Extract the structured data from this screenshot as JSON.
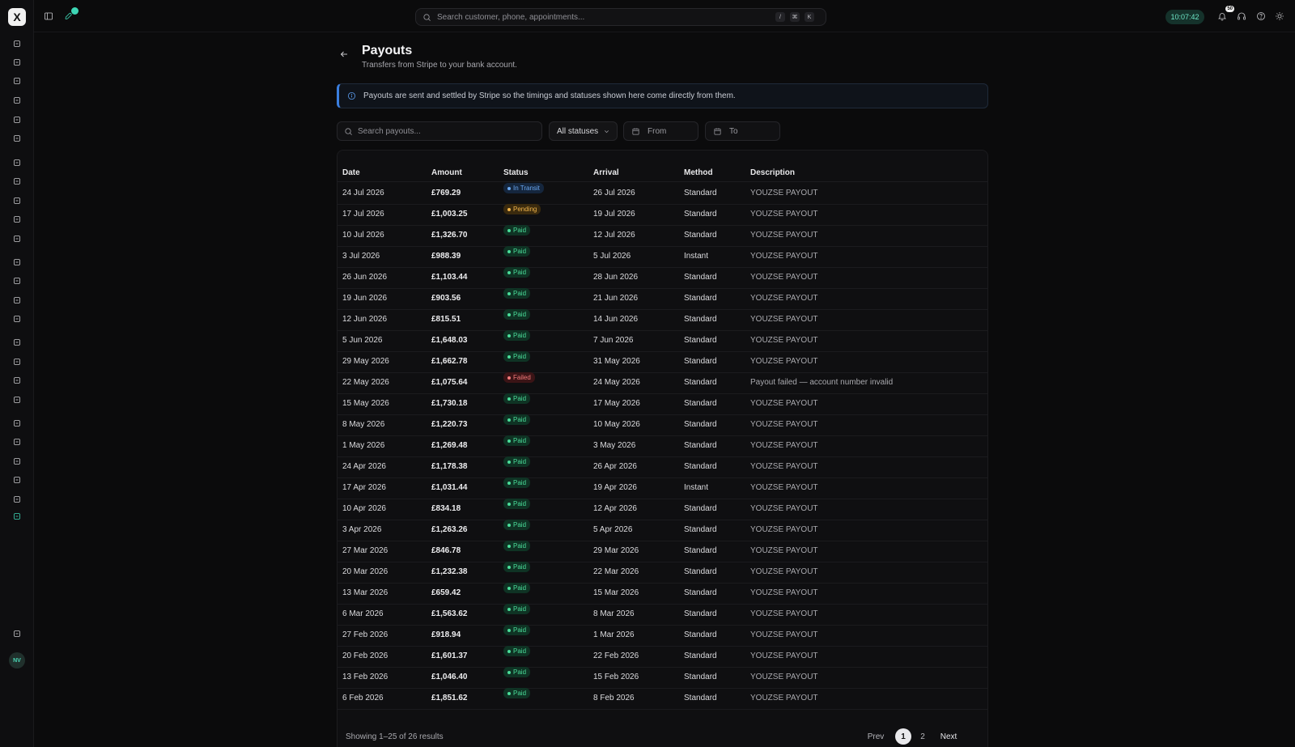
{
  "app": {
    "logo_letter": "X",
    "avatar_initials": "NV"
  },
  "topbar": {
    "search_placeholder": "Search customer, phone, appointments...",
    "kbd": [
      "/",
      "⌘",
      "K"
    ],
    "clock": "10:07:42",
    "notifications_count": "50"
  },
  "page": {
    "title": "Payouts",
    "subtitle": "Transfers from Stripe to your bank account.",
    "banner": "Payouts are sent and settled by Stripe so the timings and statuses shown here come directly from them."
  },
  "filters": {
    "search_placeholder": "Search payouts...",
    "status_selected": "All statuses",
    "from_placeholder": "From",
    "to_placeholder": "To"
  },
  "table": {
    "columns": [
      "Date",
      "Amount",
      "Status",
      "Arrival",
      "Method",
      "Description"
    ],
    "rows": [
      {
        "date": "24 Jul 2026",
        "amount": "£769.29",
        "status": "In Transit",
        "arrival": "26 Jul 2026",
        "method": "Standard",
        "description": "YOUZSE PAYOUT"
      },
      {
        "date": "17 Jul 2026",
        "amount": "£1,003.25",
        "status": "Pending",
        "arrival": "19 Jul 2026",
        "method": "Standard",
        "description": "YOUZSE PAYOUT"
      },
      {
        "date": "10 Jul 2026",
        "amount": "£1,326.70",
        "status": "Paid",
        "arrival": "12 Jul 2026",
        "method": "Standard",
        "description": "YOUZSE PAYOUT"
      },
      {
        "date": "3 Jul 2026",
        "amount": "£988.39",
        "status": "Paid",
        "arrival": "5 Jul 2026",
        "method": "Instant",
        "description": "YOUZSE PAYOUT"
      },
      {
        "date": "26 Jun 2026",
        "amount": "£1,103.44",
        "status": "Paid",
        "arrival": "28 Jun 2026",
        "method": "Standard",
        "description": "YOUZSE PAYOUT"
      },
      {
        "date": "19 Jun 2026",
        "amount": "£903.56",
        "status": "Paid",
        "arrival": "21 Jun 2026",
        "method": "Standard",
        "description": "YOUZSE PAYOUT"
      },
      {
        "date": "12 Jun 2026",
        "amount": "£815.51",
        "status": "Paid",
        "arrival": "14 Jun 2026",
        "method": "Standard",
        "description": "YOUZSE PAYOUT"
      },
      {
        "date": "5 Jun 2026",
        "amount": "£1,648.03",
        "status": "Paid",
        "arrival": "7 Jun 2026",
        "method": "Standard",
        "description": "YOUZSE PAYOUT"
      },
      {
        "date": "29 May 2026",
        "amount": "£1,662.78",
        "status": "Paid",
        "arrival": "31 May 2026",
        "method": "Standard",
        "description": "YOUZSE PAYOUT"
      },
      {
        "date": "22 May 2026",
        "amount": "£1,075.64",
        "status": "Failed",
        "arrival": "24 May 2026",
        "method": "Standard",
        "description": "Payout failed — account number invalid"
      },
      {
        "date": "15 May 2026",
        "amount": "£1,730.18",
        "status": "Paid",
        "arrival": "17 May 2026",
        "method": "Standard",
        "description": "YOUZSE PAYOUT"
      },
      {
        "date": "8 May 2026",
        "amount": "£1,220.73",
        "status": "Paid",
        "arrival": "10 May 2026",
        "method": "Standard",
        "description": "YOUZSE PAYOUT"
      },
      {
        "date": "1 May 2026",
        "amount": "£1,269.48",
        "status": "Paid",
        "arrival": "3 May 2026",
        "method": "Standard",
        "description": "YOUZSE PAYOUT"
      },
      {
        "date": "24 Apr 2026",
        "amount": "£1,178.38",
        "status": "Paid",
        "arrival": "26 Apr 2026",
        "method": "Standard",
        "description": "YOUZSE PAYOUT"
      },
      {
        "date": "17 Apr 2026",
        "amount": "£1,031.44",
        "status": "Paid",
        "arrival": "19 Apr 2026",
        "method": "Instant",
        "description": "YOUZSE PAYOUT"
      },
      {
        "date": "10 Apr 2026",
        "amount": "£834.18",
        "status": "Paid",
        "arrival": "12 Apr 2026",
        "method": "Standard",
        "description": "YOUZSE PAYOUT"
      },
      {
        "date": "3 Apr 2026",
        "amount": "£1,263.26",
        "status": "Paid",
        "arrival": "5 Apr 2026",
        "method": "Standard",
        "description": "YOUZSE PAYOUT"
      },
      {
        "date": "27 Mar 2026",
        "amount": "£846.78",
        "status": "Paid",
        "arrival": "29 Mar 2026",
        "method": "Standard",
        "description": "YOUZSE PAYOUT"
      },
      {
        "date": "20 Mar 2026",
        "amount": "£1,232.38",
        "status": "Paid",
        "arrival": "22 Mar 2026",
        "method": "Standard",
        "description": "YOUZSE PAYOUT"
      },
      {
        "date": "13 Mar 2026",
        "amount": "£659.42",
        "status": "Paid",
        "arrival": "15 Mar 2026",
        "method": "Standard",
        "description": "YOUZSE PAYOUT"
      },
      {
        "date": "6 Mar 2026",
        "amount": "£1,563.62",
        "status": "Paid",
        "arrival": "8 Mar 2026",
        "method": "Standard",
        "description": "YOUZSE PAYOUT"
      },
      {
        "date": "27 Feb 2026",
        "amount": "£918.94",
        "status": "Paid",
        "arrival": "1 Mar 2026",
        "method": "Standard",
        "description": "YOUZSE PAYOUT"
      },
      {
        "date": "20 Feb 2026",
        "amount": "£1,601.37",
        "status": "Paid",
        "arrival": "22 Feb 2026",
        "method": "Standard",
        "description": "YOUZSE PAYOUT"
      },
      {
        "date": "13 Feb 2026",
        "amount": "£1,046.40",
        "status": "Paid",
        "arrival": "15 Feb 2026",
        "method": "Standard",
        "description": "YOUZSE PAYOUT"
      },
      {
        "date": "6 Feb 2026",
        "amount": "£1,851.62",
        "status": "Paid",
        "arrival": "8 Feb 2026",
        "method": "Standard",
        "description": "YOUZSE PAYOUT"
      }
    ]
  },
  "pagination": {
    "showing": "Showing 1–25 of 26 results",
    "prev": "Prev",
    "pages": [
      "1",
      "2"
    ],
    "next": "Next"
  },
  "colors": {
    "accent": "#3dd6b5",
    "info": "#3b7fe0",
    "paid": "#4ade9a",
    "pending": "#f0b44a",
    "failed": "#f37a7a",
    "transit": "#6aa8f2"
  },
  "icons": {
    "sidebar": [
      "rocket-icon",
      "home-icon",
      "calendar-icon",
      "book-icon",
      "hourglass-icon",
      "graduation-cap-icon",
      "inbox-icon",
      "users-icon",
      "store-icon",
      "register-icon",
      "star-icon",
      "file-icon",
      "ledger-icon",
      "bank-icon",
      "gift-icon",
      "megaphone-icon",
      "clipboard-icon",
      "team-icon",
      "clock-icon",
      "puzzle-icon",
      "checklist-icon",
      "user-check-icon",
      "bar-chart-icon",
      "folder-icon",
      "settings-icon",
      "sliders-icon"
    ]
  }
}
